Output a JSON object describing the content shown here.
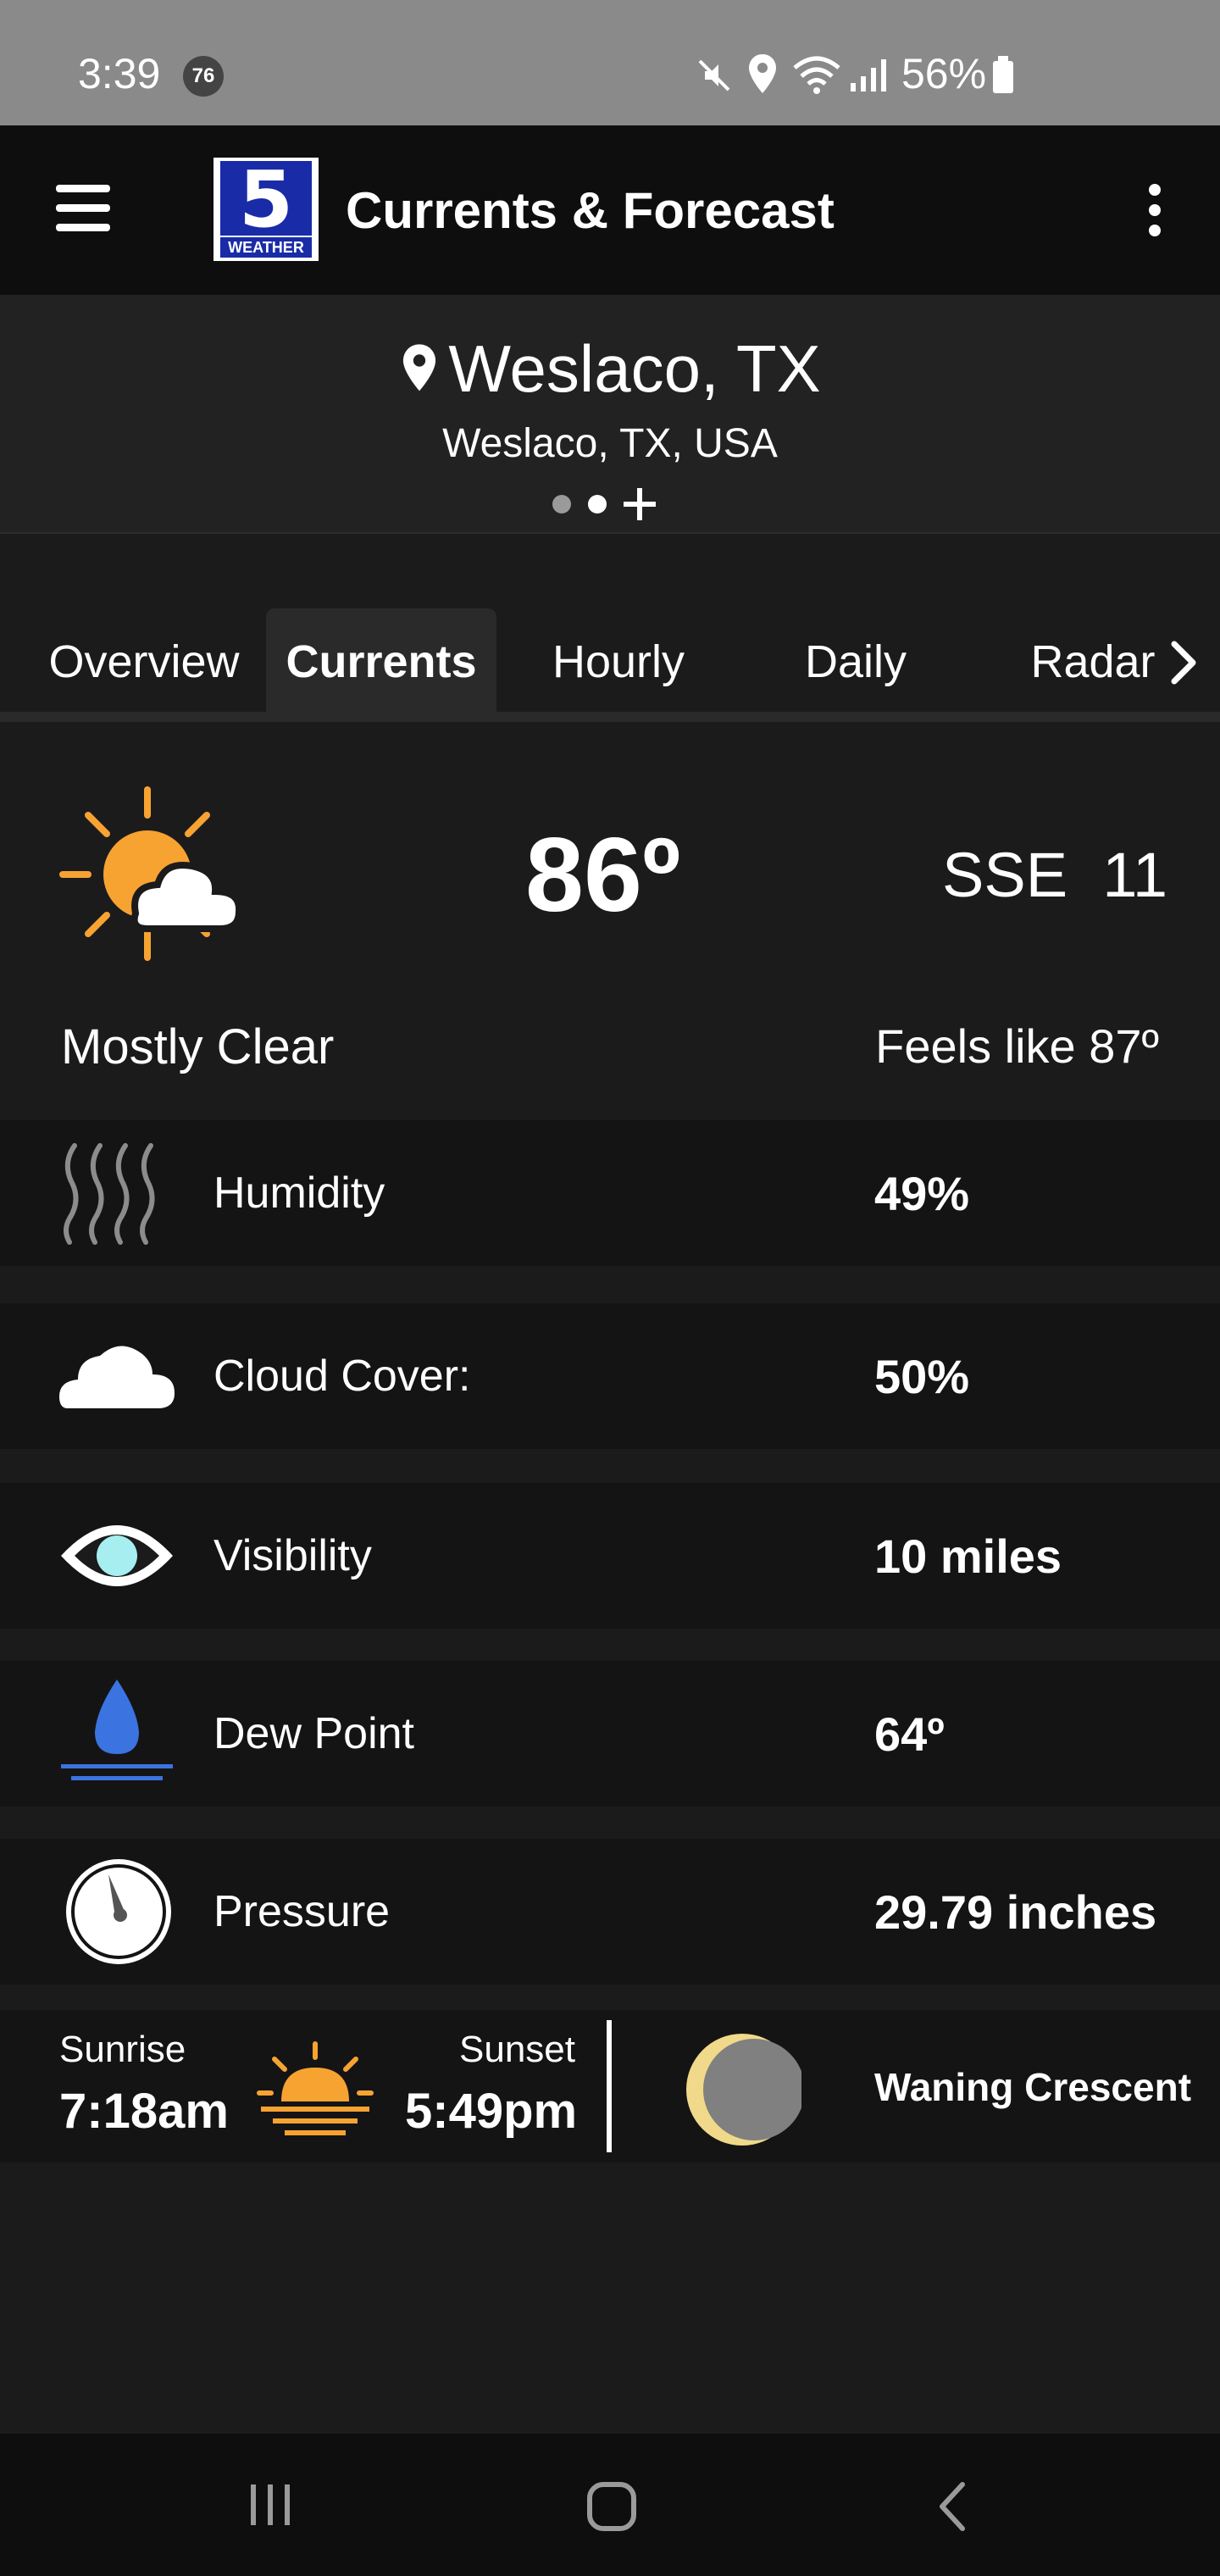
{
  "status_bar": {
    "time": "3:39",
    "notification_count": "76",
    "battery": "56%"
  },
  "app_bar": {
    "title": "Currents & Forecast",
    "logo_number": "5",
    "logo_text": "WEATHER"
  },
  "location": {
    "city": "Weslaco, TX",
    "full": "Weslaco, TX, USA",
    "page_dots": 2,
    "active_dot": 1
  },
  "tabs": [
    {
      "label": "Overview",
      "active": false
    },
    {
      "label": "Currents",
      "active": true
    },
    {
      "label": "Hourly",
      "active": false
    },
    {
      "label": "Daily",
      "active": false
    },
    {
      "label": "Radar",
      "active": false
    }
  ],
  "current": {
    "icon": "partly-cloudy-sun-icon",
    "temperature": "86º",
    "wind": "SSE  11",
    "condition": "Mostly Clear",
    "feels_like": "Feels like 87º"
  },
  "details": [
    {
      "icon": "humidity-icon",
      "label": "Humidity",
      "value": "49%"
    },
    {
      "icon": "cloud-icon",
      "label": "Cloud Cover:",
      "value": "50%"
    },
    {
      "icon": "eye-icon",
      "label": "Visibility",
      "value": "10 miles"
    },
    {
      "icon": "droplet-icon",
      "label": "Dew Point",
      "value": "64º"
    },
    {
      "icon": "gauge-icon",
      "label": "Pressure",
      "value": "29.79 inches"
    }
  ],
  "sun_moon": {
    "sunrise_label": "Sunrise",
    "sunrise_time": "7:18am",
    "sunset_label": "Sunset",
    "sunset_time": "5:49pm",
    "moon_phase": "Waning Crescent"
  },
  "colors": {
    "sun": "#f7a332",
    "droplet": "#3b74e0",
    "eye_iris": "#a6eef0"
  }
}
